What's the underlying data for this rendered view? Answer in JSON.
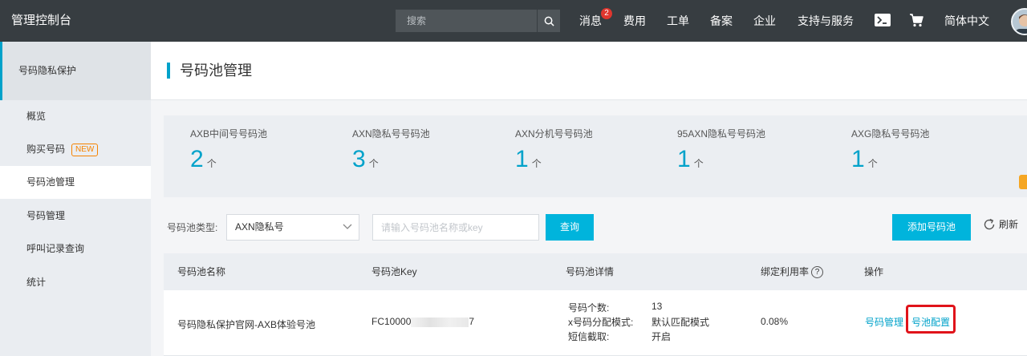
{
  "topbar": {
    "brand": "管理控制台",
    "search_placeholder": "搜索",
    "nav": {
      "messages": "消息",
      "messages_badge": "2",
      "billing": "费用",
      "tickets": "工单",
      "icp": "备案",
      "enterprise": "企业",
      "support": "支持与服务",
      "language": "简体中文"
    },
    "icons": [
      "search-icon",
      "terminal-icon",
      "cart-icon",
      "avatar"
    ]
  },
  "sidebar": {
    "header": "号码隐私保护",
    "items": [
      {
        "label": "概览"
      },
      {
        "label": "购买号码",
        "tag": "NEW"
      },
      {
        "label": "号码池管理"
      },
      {
        "label": "号码管理"
      },
      {
        "label": "呼叫记录查询"
      },
      {
        "label": "统计"
      }
    ]
  },
  "main": {
    "title": "号码池管理",
    "stats": [
      {
        "label": "AXB中间号号码池",
        "value": "2",
        "unit": "个"
      },
      {
        "label": "AXN隐私号号码池",
        "value": "3",
        "unit": "个"
      },
      {
        "label": "AXN分机号号码池",
        "value": "1",
        "unit": "个"
      },
      {
        "label": "95AXN隐私号号码池",
        "value": "1",
        "unit": "个"
      },
      {
        "label": "AXG隐私号号码池",
        "value": "1",
        "unit": "个"
      }
    ],
    "filter": {
      "type_label": "号码池类型:",
      "type_value": "AXN隐私号",
      "name_placeholder": "请输入号码池名称或key",
      "query_button": "查询",
      "add_button": "添加号码池",
      "refresh_label": "刷新"
    },
    "table": {
      "headers": [
        "号码池名称",
        "号码池Key",
        "号码池详情",
        "绑定利用率",
        "操作"
      ],
      "rows": [
        {
          "name": "号码隐私保护官网-AXB体验号池",
          "key_prefix": "FC10000",
          "key_suffix": "7",
          "details": [
            {
              "label": "号码个数:",
              "value": "13"
            },
            {
              "label": "x号码分配模式:",
              "value": "默认匹配模式"
            },
            {
              "label": "短信截取:",
              "value": "开启"
            }
          ],
          "utilization": "0.08%",
          "actions": [
            "号码管理",
            "号池配置"
          ]
        }
      ]
    }
  },
  "colors": {
    "topbar": "#373d41",
    "accent": "#00a2ca",
    "primary_button": "#00b4dc",
    "highlight": "#e0131a",
    "new_tag": "#f68300"
  }
}
